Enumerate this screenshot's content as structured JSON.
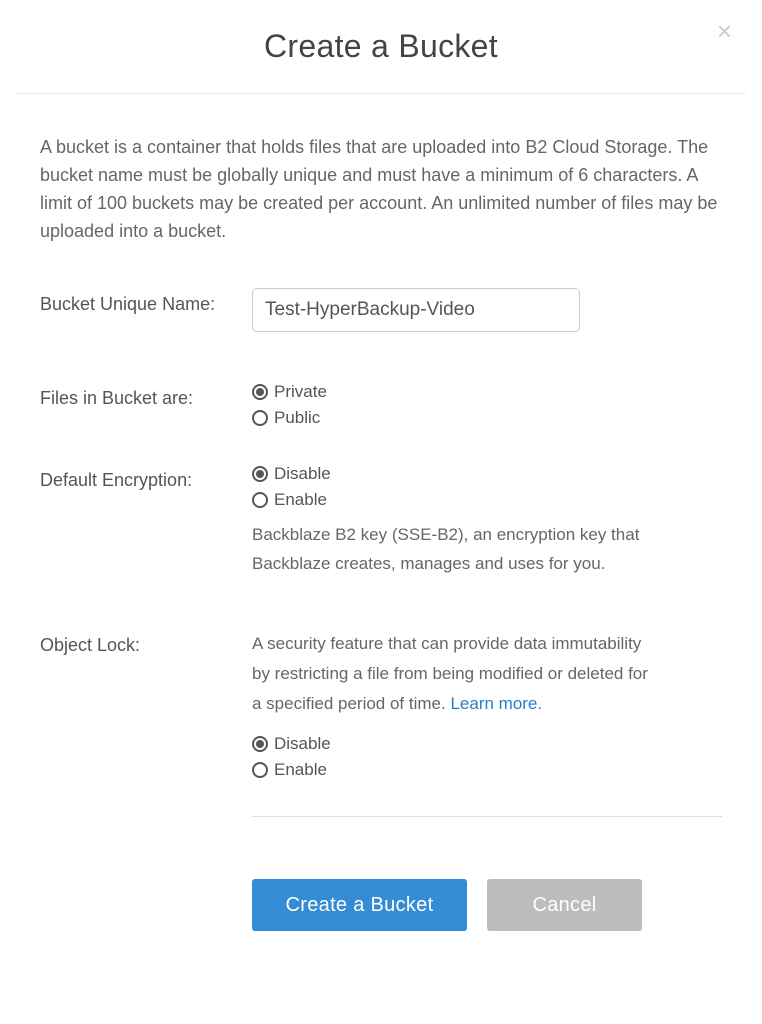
{
  "dialog": {
    "title": "Create a Bucket",
    "description": "A bucket is a container that holds files that are uploaded into B2 Cloud Storage. The bucket name must be globally unique and must have a minimum of 6 characters. A limit of 100 buckets may be created per account. An unlimited number of files may be uploaded into a bucket."
  },
  "form": {
    "bucket_name": {
      "label": "Bucket Unique Name:",
      "value": "Test-HyperBackup-Video"
    },
    "files_visibility": {
      "label": "Files in Bucket are:",
      "options": {
        "private": "Private",
        "public": "Public"
      }
    },
    "encryption": {
      "label": "Default Encryption:",
      "options": {
        "disable": "Disable",
        "enable": "Enable"
      },
      "helper": "Backblaze B2 key (SSE-B2), an encryption key that Backblaze creates, manages and uses for you."
    },
    "object_lock": {
      "label": "Object Lock:",
      "helper_pre": "A security feature that can provide data immutability by restricting a file from being modified or deleted for a specified period of time. ",
      "learn_more": "Learn more.",
      "options": {
        "disable": "Disable",
        "enable": "Enable"
      }
    }
  },
  "buttons": {
    "create": "Create a Bucket",
    "cancel": "Cancel"
  }
}
